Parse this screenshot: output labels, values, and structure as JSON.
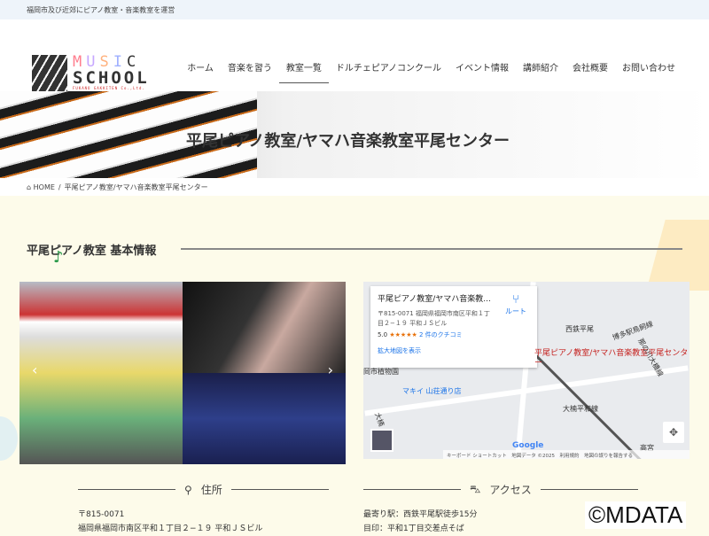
{
  "topbar": {
    "tagline": "福岡市及び近郊にピアノ教室・音楽教室を運営"
  },
  "logo": {
    "music": [
      "M",
      "U",
      "S",
      "I",
      "C"
    ],
    "school": "SCHOOL",
    "company": "FUKANO GAKKITEN Co.,Ltd."
  },
  "nav": [
    {
      "label": "ホーム"
    },
    {
      "label": "音楽を習う"
    },
    {
      "label": "教室一覧",
      "active": true
    },
    {
      "label": "ドルチェピアノコンクール"
    },
    {
      "label": "イベント情報"
    },
    {
      "label": "講師紹介"
    },
    {
      "label": "会社概要"
    },
    {
      "label": "お問い合わせ"
    }
  ],
  "hero": {
    "title": "平尾ピアノ教室/ヤマハ音楽教室平尾センター"
  },
  "breadcrumb": {
    "home": "HOME",
    "sep": "/",
    "current": "平尾ピアノ教室/ヤマハ音楽教室平尾センター"
  },
  "section": {
    "title": "平尾ピアノ教室 基本情報"
  },
  "slider": {
    "prev": "‹",
    "next": "›"
  },
  "map": {
    "name": "平尾ピアノ教室/ヤマハ音楽教...",
    "address": "〒815-0071 福岡県福岡市南区平和１丁目２−１９ 平和ＪＳビル",
    "rating": "5.0",
    "stars": "★★★★★",
    "reviews": "2 件のクチコミ",
    "route": "ルート",
    "larger": "拡大地図を表示",
    "pin": "平尾ピアノ教室/ヤマハ音楽教室平尾センター",
    "labels": {
      "station": "西鉄平尾",
      "store": "マキイ 山荘通り店",
      "garden": "岡市植物園",
      "line1": "博多駅鳥飼線",
      "line2": "大楠平和線",
      "line3": "大楠",
      "road": "那の川大橋線",
      "takamiya": "高宮"
    },
    "google": "Google",
    "footer": "キーボード ショートカット　地図データ ©2025　利用規約　地図の誤りを報告する"
  },
  "address": {
    "heading": "住所",
    "zip": "〒815-0071",
    "line": "福岡県福岡市南区平和１丁目２−１９ 平和ＪＳビル"
  },
  "access": {
    "heading": "アクセス",
    "nearest": "最寄り駅：西鉄平尾駅徒歩15分",
    "landmark": "目印：平和1丁目交差点そば"
  },
  "watermark": "©MDATA"
}
